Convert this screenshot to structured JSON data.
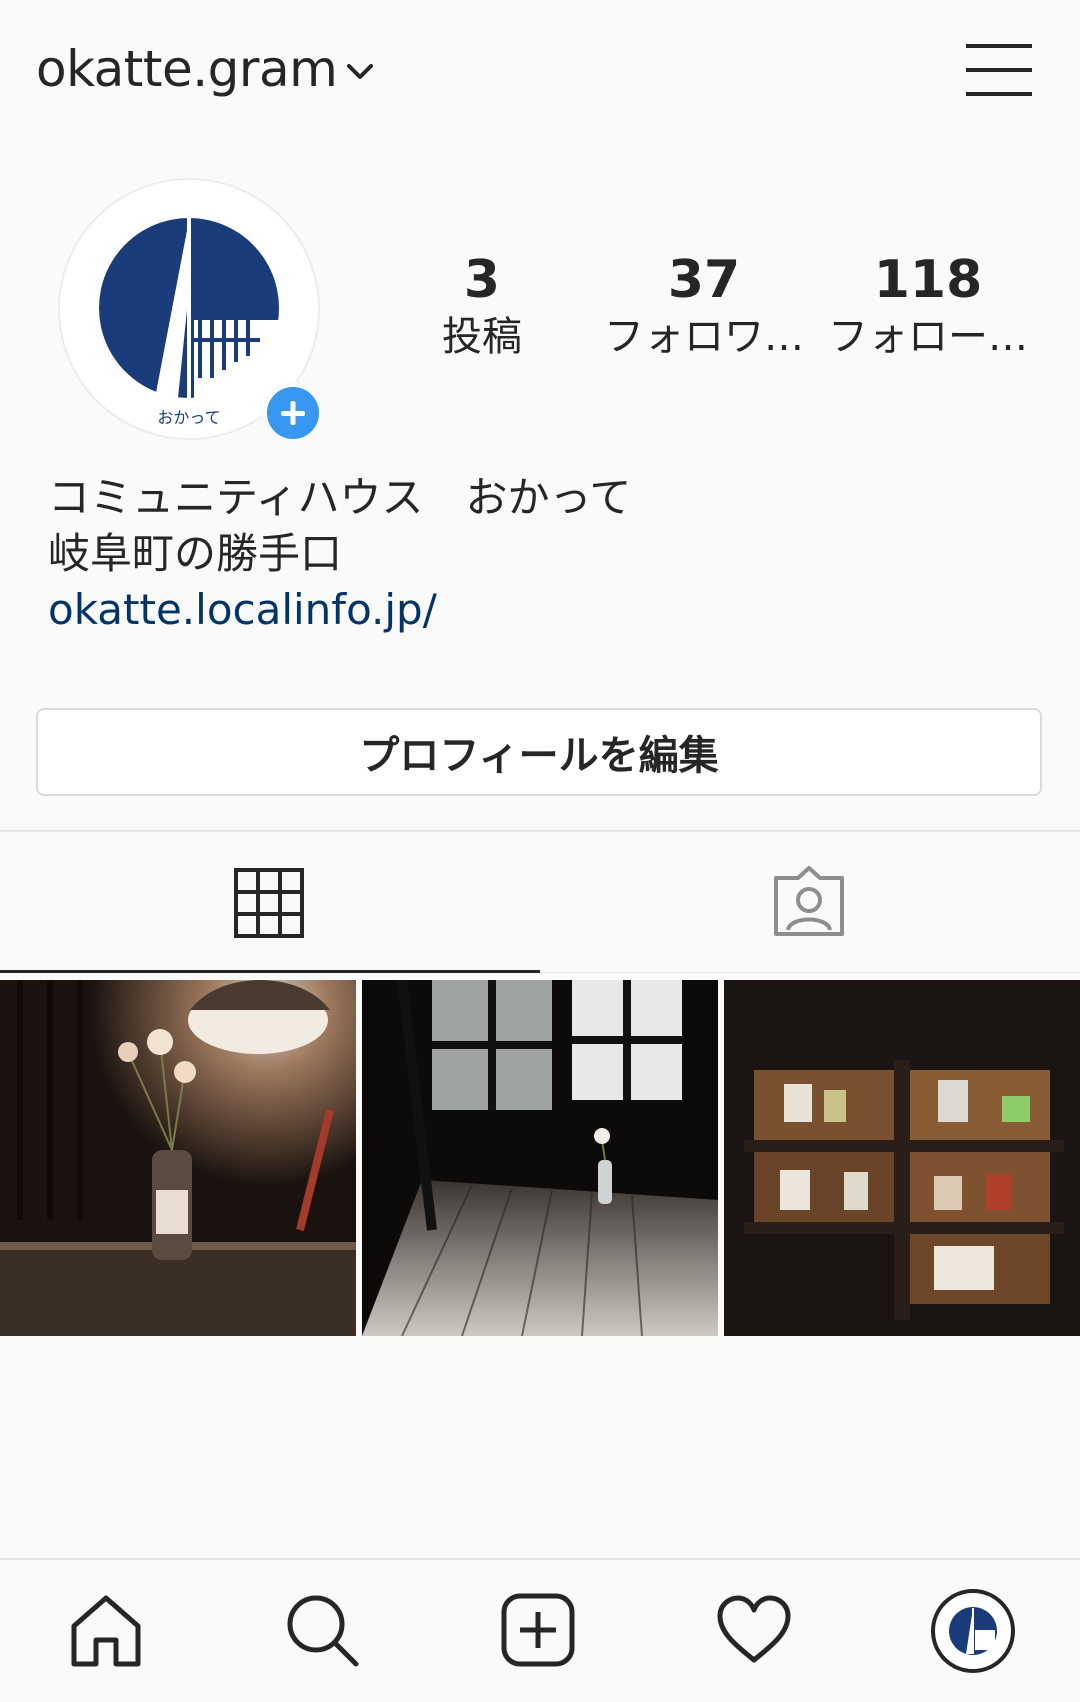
{
  "header": {
    "username": "okatte.gram",
    "dropdown_icon": "chevron-down-icon",
    "menu_icon": "hamburger-menu-icon"
  },
  "profile": {
    "avatar_caption": "おかって",
    "add_story_icon": "plus-circle-icon",
    "stats": [
      {
        "value": "3",
        "label": "投稿"
      },
      {
        "value": "37",
        "label": "フォロワ…"
      },
      {
        "value": "118",
        "label": "フォロー…"
      }
    ],
    "bio": {
      "name": "コミュニティハウス　おかって",
      "tagline": "岐阜町の勝手口",
      "link": "okatte.localinfo.jp/"
    },
    "edit_button_label": "プロフィールを編集"
  },
  "tabs": [
    {
      "icon": "grid-icon",
      "active": true
    },
    {
      "icon": "tagged-photos-icon",
      "active": false
    }
  ],
  "bottom_nav": [
    {
      "icon": "home-icon"
    },
    {
      "icon": "search-icon"
    },
    {
      "icon": "add-post-icon"
    },
    {
      "icon": "heart-icon"
    },
    {
      "icon": "profile-avatar-icon"
    }
  ],
  "colors": {
    "accent_blue": "#3897f0",
    "link_blue": "#003569",
    "logo_navy": "#1a3c7a",
    "text": "#262626",
    "background": "#fafafa"
  }
}
